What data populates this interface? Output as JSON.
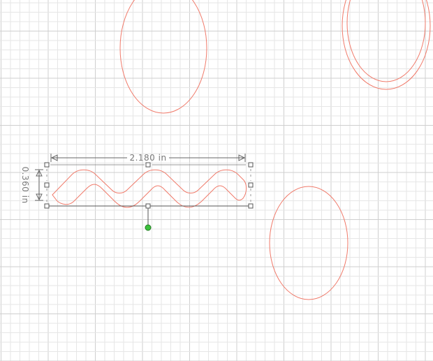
{
  "canvas": {
    "background": "#ffffff",
    "grid_minor_color": "#e6e6e6",
    "grid_major_color": "#cfcfcf",
    "shape_stroke_color": "#f07a6a"
  },
  "selection": {
    "width_label": "2.180 in",
    "height_label": "0.360 in",
    "handle_color": "#555555",
    "rotate_handle_color": "#3cc13c"
  },
  "shapes": [
    {
      "type": "ellipse",
      "name": "top-center-ellipse"
    },
    {
      "type": "double-ellipse",
      "name": "top-right-double-ellipse"
    },
    {
      "type": "ellipse",
      "name": "bottom-right-ellipse"
    },
    {
      "type": "wavy-line",
      "name": "selected-wave-shape"
    }
  ]
}
